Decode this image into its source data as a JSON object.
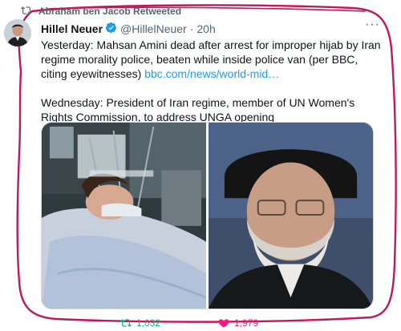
{
  "retweet": {
    "label": "Abraham ben Jacob Retweeted",
    "icon": "retweet-icon"
  },
  "tweet": {
    "author_name": "Hillel Neuer",
    "handle": "@HillelNeuer",
    "separator": "·",
    "time": "20h",
    "more_label": "···",
    "line1": "Yesterday: Mahsan Amini dead after arrest for improper hijab by Iran regime morality police, beaten while inside police van (per BBC, citing eyewitnesses) ",
    "link": "bbc.com/news/world-mid…",
    "line2": "Wednesday: President of Iran regime, member of UN Women's Rights Commission, to address UNGA opening"
  },
  "actions": {
    "retweets": "1,032",
    "likes": "1,979"
  },
  "colors": {
    "accent": "#1d9bf0",
    "frame": "#c2185b",
    "muted": "#536471",
    "like": "#f91880"
  }
}
